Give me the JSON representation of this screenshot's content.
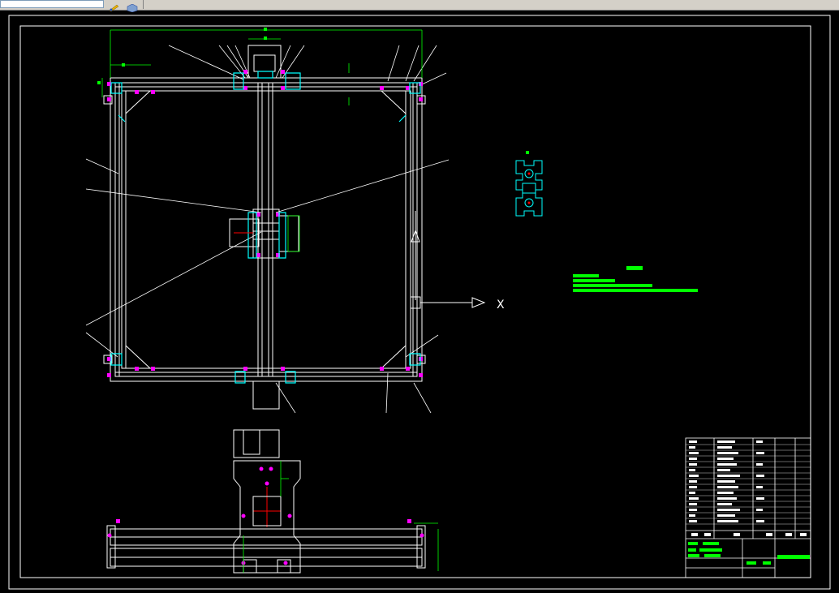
{
  "window": {
    "toolbar": {
      "address_value": "",
      "tools": [
        {
          "name": "pencil-icon"
        },
        {
          "name": "cube-icon"
        }
      ]
    }
  },
  "drawing": {
    "colors": {
      "background": "#000000",
      "frame": "#ffffff",
      "dimension": "#00ff00",
      "bolt": "#ff00ff",
      "bracket": "#00ffff",
      "axis_marker": "#ff0000"
    },
    "axis_label": "X"
  }
}
